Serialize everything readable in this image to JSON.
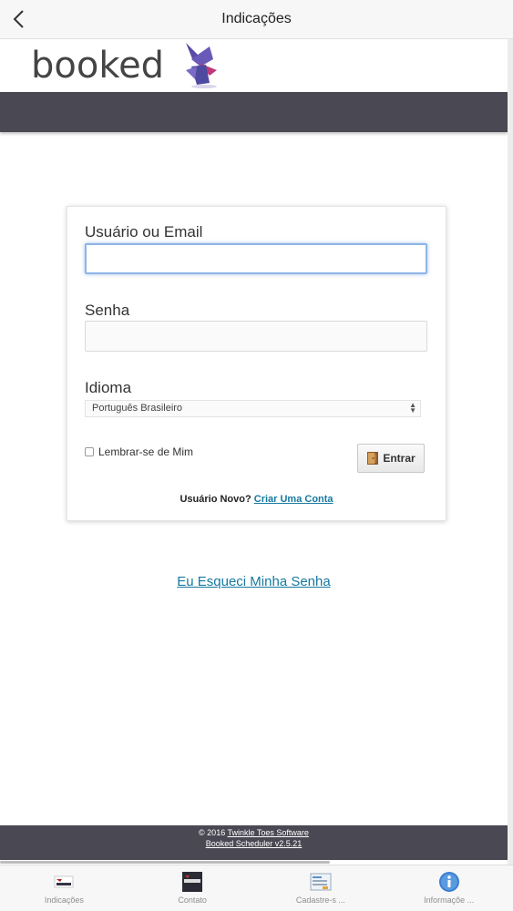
{
  "nav": {
    "title": "Indicações"
  },
  "logo": {
    "text": "booked"
  },
  "login": {
    "username_label": "Usuário ou Email",
    "password_label": "Senha",
    "language_label": "Idioma",
    "language_value": "Português Brasileiro",
    "remember_label": "Lembrar-se de Mim",
    "enter_label": "Entrar",
    "new_user_text": "Usuário Novo?",
    "create_account_link": "Criar Uma Conta"
  },
  "forgot_link": "Eu Esqueci Minha Senha",
  "footer": {
    "copyright_prefix": "© 2016",
    "company_link": "Twinkle Toes Software",
    "version_link": "Booked Scheduler v2.5.21"
  },
  "tabs": [
    {
      "label": "Indicações",
      "icon": "indica-icon"
    },
    {
      "label": "Contato",
      "icon": "contato-icon"
    },
    {
      "label": "Cadastre-s ...",
      "icon": "form-icon"
    },
    {
      "label": "Informaçõe ...",
      "icon": "info-icon"
    }
  ],
  "colors": {
    "header": "#4a4853",
    "link": "#16799f",
    "focus": "#8fb5e6"
  }
}
